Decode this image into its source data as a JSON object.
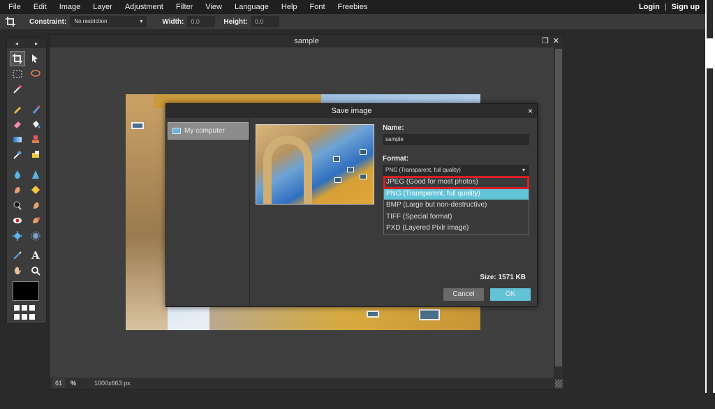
{
  "menu": {
    "items": [
      "File",
      "Edit",
      "Image",
      "Layer",
      "Adjustment",
      "Filter",
      "View",
      "Language",
      "Help",
      "Font",
      "Freebies"
    ],
    "login": "Login",
    "separator": "|",
    "signup": "Sign up"
  },
  "options": {
    "constraint_label": "Constraint:",
    "constraint_value": "No restriction",
    "width_label": "Width:",
    "width_value": "0.0",
    "height_label": "Height:",
    "height_value": "0.0"
  },
  "toolbox": {
    "nav_left": "◂",
    "nav_right": "▸",
    "tools": [
      "crop-icon",
      "move-icon",
      "marquee-icon",
      "lasso-icon",
      "wand-icon",
      "pencil-icon",
      "brush-icon",
      "eraser-icon",
      "bucket-icon",
      "gradient-icon",
      "stamp-icon",
      "picker-icon",
      "healing-icon",
      "blur-icon",
      "sharpen-icon",
      "smudge-icon",
      "sponge-icon",
      "dodge-icon",
      "burn-icon",
      "redeye-icon",
      "spot-heal-icon",
      "bloat-icon",
      "pinch-icon",
      "pen-icon",
      "text-icon",
      "hand-icon",
      "zoom-icon"
    ],
    "foreground_color": "#000000"
  },
  "document": {
    "title": "sample",
    "zoom": "61",
    "zoom_unit": "%",
    "dimensions": "1000x663 px"
  },
  "dialog": {
    "title": "Save image",
    "close": "×",
    "location": "My computer",
    "name_label": "Name:",
    "name_value": "sample",
    "format_label": "Format:",
    "format_value": "PNG (Transparent, full quality)",
    "format_options": [
      "JPEG (Good for most photos)",
      "PNG (Transparent, full quality)",
      "BMP (Large but non-destructive)",
      "TIFF (Special format)",
      "PXD (Layered Pixlr image)"
    ],
    "size_text": "Size: 1571 KB",
    "cancel_label": "Cancel",
    "ok_label": "OK"
  },
  "colors": {
    "accent": "#63c3d6",
    "highlight_box": "#d81f26",
    "background": "#2a2a2a"
  }
}
